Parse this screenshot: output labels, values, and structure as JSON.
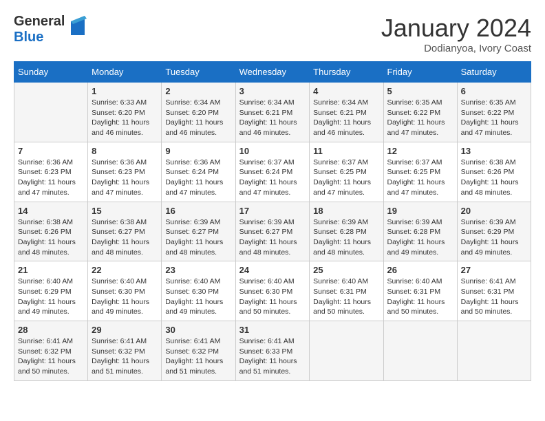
{
  "header": {
    "logo_general": "General",
    "logo_blue": "Blue",
    "month_year": "January 2024",
    "location": "Dodianyoa, Ivory Coast"
  },
  "days_of_week": [
    "Sunday",
    "Monday",
    "Tuesday",
    "Wednesday",
    "Thursday",
    "Friday",
    "Saturday"
  ],
  "weeks": [
    [
      {
        "day": "",
        "info": ""
      },
      {
        "day": "1",
        "info": "Sunrise: 6:33 AM\nSunset: 6:20 PM\nDaylight: 11 hours and 46 minutes."
      },
      {
        "day": "2",
        "info": "Sunrise: 6:34 AM\nSunset: 6:20 PM\nDaylight: 11 hours and 46 minutes."
      },
      {
        "day": "3",
        "info": "Sunrise: 6:34 AM\nSunset: 6:21 PM\nDaylight: 11 hours and 46 minutes."
      },
      {
        "day": "4",
        "info": "Sunrise: 6:34 AM\nSunset: 6:21 PM\nDaylight: 11 hours and 46 minutes."
      },
      {
        "day": "5",
        "info": "Sunrise: 6:35 AM\nSunset: 6:22 PM\nDaylight: 11 hours and 47 minutes."
      },
      {
        "day": "6",
        "info": "Sunrise: 6:35 AM\nSunset: 6:22 PM\nDaylight: 11 hours and 47 minutes."
      }
    ],
    [
      {
        "day": "7",
        "info": "Sunrise: 6:36 AM\nSunset: 6:23 PM\nDaylight: 11 hours and 47 minutes."
      },
      {
        "day": "8",
        "info": "Sunrise: 6:36 AM\nSunset: 6:23 PM\nDaylight: 11 hours and 47 minutes."
      },
      {
        "day": "9",
        "info": "Sunrise: 6:36 AM\nSunset: 6:24 PM\nDaylight: 11 hours and 47 minutes."
      },
      {
        "day": "10",
        "info": "Sunrise: 6:37 AM\nSunset: 6:24 PM\nDaylight: 11 hours and 47 minutes."
      },
      {
        "day": "11",
        "info": "Sunrise: 6:37 AM\nSunset: 6:25 PM\nDaylight: 11 hours and 47 minutes."
      },
      {
        "day": "12",
        "info": "Sunrise: 6:37 AM\nSunset: 6:25 PM\nDaylight: 11 hours and 47 minutes."
      },
      {
        "day": "13",
        "info": "Sunrise: 6:38 AM\nSunset: 6:26 PM\nDaylight: 11 hours and 48 minutes."
      }
    ],
    [
      {
        "day": "14",
        "info": "Sunrise: 6:38 AM\nSunset: 6:26 PM\nDaylight: 11 hours and 48 minutes."
      },
      {
        "day": "15",
        "info": "Sunrise: 6:38 AM\nSunset: 6:27 PM\nDaylight: 11 hours and 48 minutes."
      },
      {
        "day": "16",
        "info": "Sunrise: 6:39 AM\nSunset: 6:27 PM\nDaylight: 11 hours and 48 minutes."
      },
      {
        "day": "17",
        "info": "Sunrise: 6:39 AM\nSunset: 6:27 PM\nDaylight: 11 hours and 48 minutes."
      },
      {
        "day": "18",
        "info": "Sunrise: 6:39 AM\nSunset: 6:28 PM\nDaylight: 11 hours and 48 minutes."
      },
      {
        "day": "19",
        "info": "Sunrise: 6:39 AM\nSunset: 6:28 PM\nDaylight: 11 hours and 49 minutes."
      },
      {
        "day": "20",
        "info": "Sunrise: 6:39 AM\nSunset: 6:29 PM\nDaylight: 11 hours and 49 minutes."
      }
    ],
    [
      {
        "day": "21",
        "info": "Sunrise: 6:40 AM\nSunset: 6:29 PM\nDaylight: 11 hours and 49 minutes."
      },
      {
        "day": "22",
        "info": "Sunrise: 6:40 AM\nSunset: 6:30 PM\nDaylight: 11 hours and 49 minutes."
      },
      {
        "day": "23",
        "info": "Sunrise: 6:40 AM\nSunset: 6:30 PM\nDaylight: 11 hours and 49 minutes."
      },
      {
        "day": "24",
        "info": "Sunrise: 6:40 AM\nSunset: 6:30 PM\nDaylight: 11 hours and 50 minutes."
      },
      {
        "day": "25",
        "info": "Sunrise: 6:40 AM\nSunset: 6:31 PM\nDaylight: 11 hours and 50 minutes."
      },
      {
        "day": "26",
        "info": "Sunrise: 6:40 AM\nSunset: 6:31 PM\nDaylight: 11 hours and 50 minutes."
      },
      {
        "day": "27",
        "info": "Sunrise: 6:41 AM\nSunset: 6:31 PM\nDaylight: 11 hours and 50 minutes."
      }
    ],
    [
      {
        "day": "28",
        "info": "Sunrise: 6:41 AM\nSunset: 6:32 PM\nDaylight: 11 hours and 50 minutes."
      },
      {
        "day": "29",
        "info": "Sunrise: 6:41 AM\nSunset: 6:32 PM\nDaylight: 11 hours and 51 minutes."
      },
      {
        "day": "30",
        "info": "Sunrise: 6:41 AM\nSunset: 6:32 PM\nDaylight: 11 hours and 51 minutes."
      },
      {
        "day": "31",
        "info": "Sunrise: 6:41 AM\nSunset: 6:33 PM\nDaylight: 11 hours and 51 minutes."
      },
      {
        "day": "",
        "info": ""
      },
      {
        "day": "",
        "info": ""
      },
      {
        "day": "",
        "info": ""
      }
    ]
  ]
}
